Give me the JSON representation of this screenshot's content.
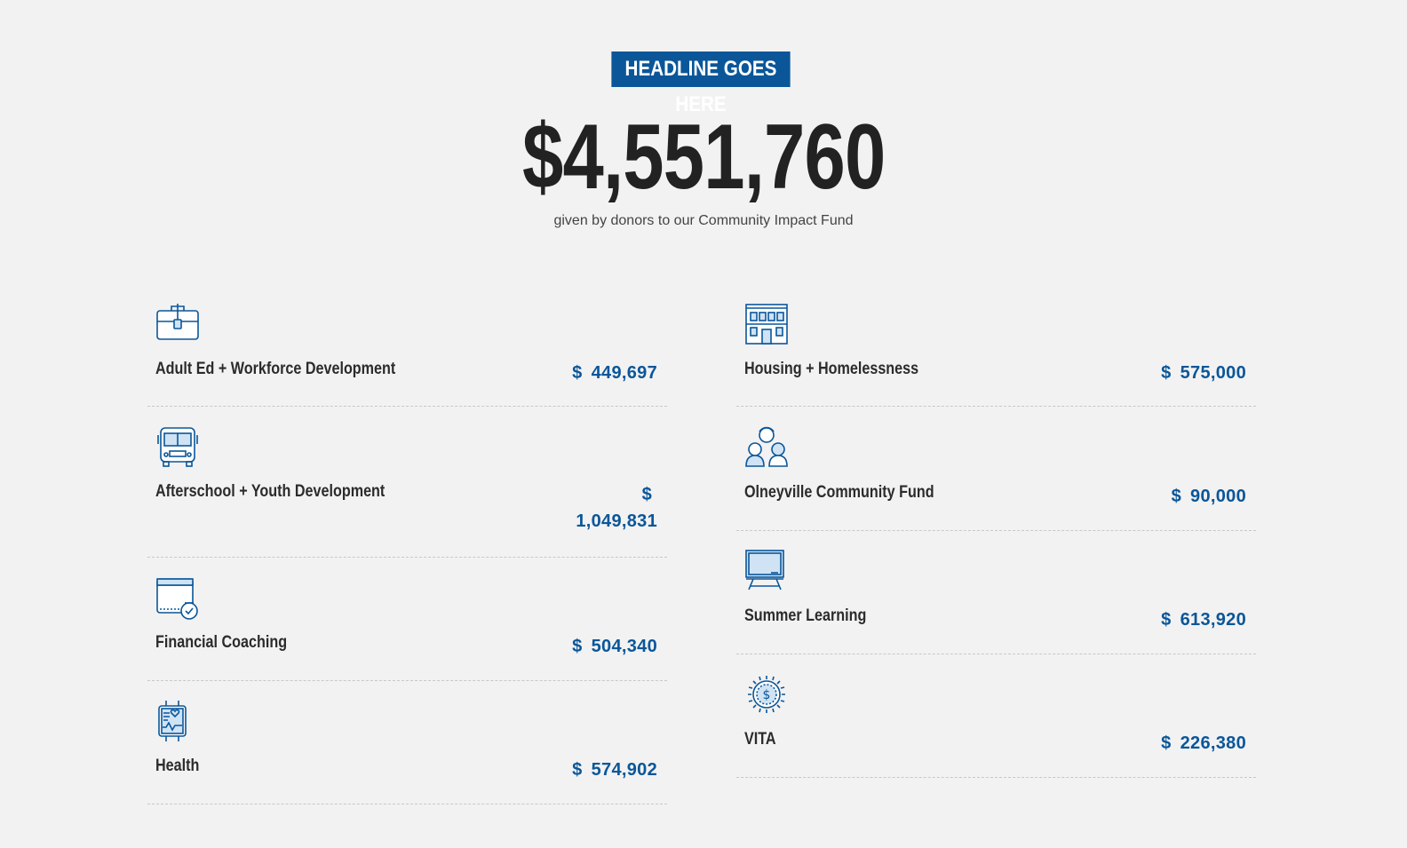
{
  "header": {
    "headline": "HEADLINE GOES HERE",
    "total": "$4,551,760",
    "subline": "given by donors to our Community Impact Fund"
  },
  "colors": {
    "background": "#f2f2f2",
    "accent_blue": "#0a5699",
    "text_dark": "#222222"
  },
  "left_column": [
    {
      "label": "Adult Ed + Workforce Development",
      "currency": "$",
      "amount": "449,697",
      "icon": "briefcase-icon"
    },
    {
      "label": "Afterschool + Youth Development",
      "currency": "$",
      "amount": "1,049,831",
      "icon": "school-bus-icon"
    },
    {
      "label": "Financial Coaching",
      "currency": "$",
      "amount": "504,340",
      "icon": "wallet-check-icon"
    },
    {
      "label": "Health",
      "currency": "$",
      "amount": "574,902",
      "icon": "heart-monitor-watch-icon"
    }
  ],
  "right_column": [
    {
      "label": "Housing + Homelessness",
      "currency": "$",
      "amount": "575,000",
      "icon": "building-icon"
    },
    {
      "label": "Olneyville Community Fund",
      "currency": "$",
      "amount": "90,000",
      "icon": "community-people-icon"
    },
    {
      "label": "Summer Learning",
      "currency": "$",
      "amount": "613,920",
      "icon": "chalkboard-icon"
    },
    {
      "label": "VITA",
      "currency": "$",
      "amount": "226,380",
      "icon": "dollar-coin-icon"
    }
  ]
}
